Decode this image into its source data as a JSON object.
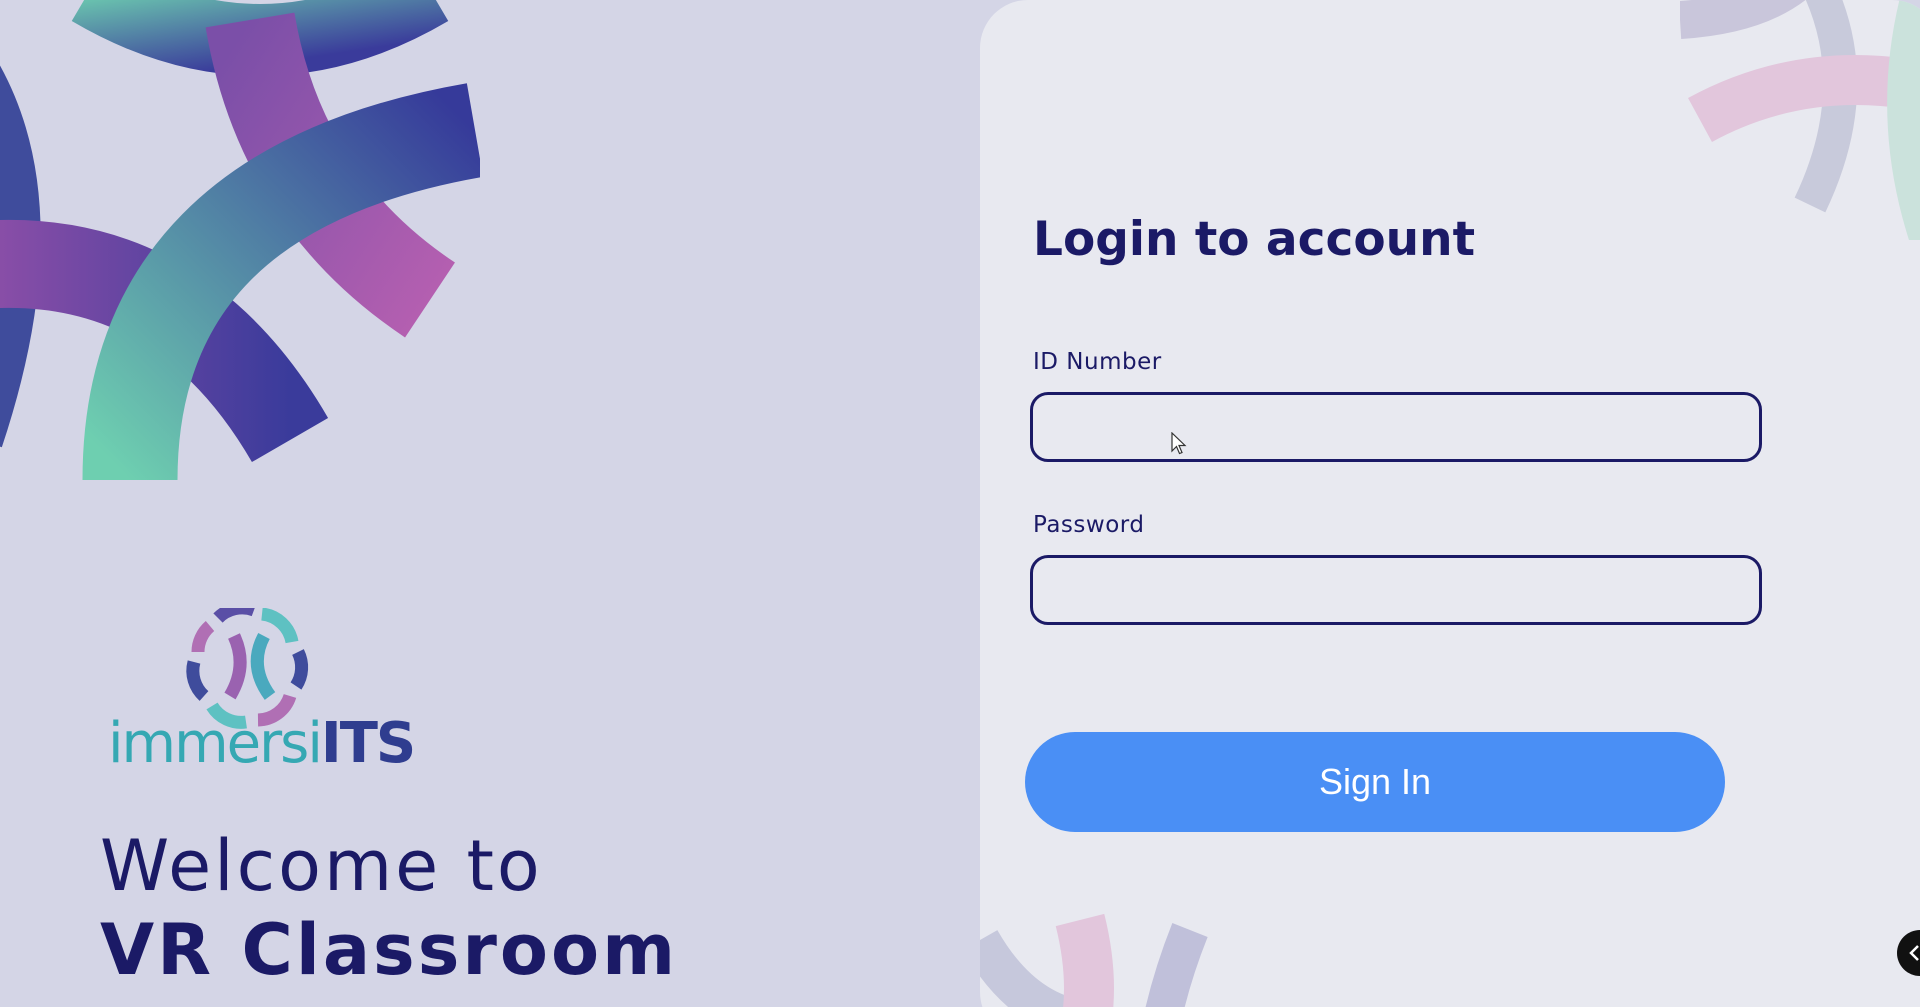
{
  "brand": {
    "logo_text_main": "immersi",
    "logo_text_accent": "ITS"
  },
  "welcome": {
    "line1": "Welcome to",
    "line2": "VR Classroom"
  },
  "login": {
    "title": "Login to account",
    "id_label": "ID Number",
    "id_value": "",
    "password_label": "Password",
    "password_value": "",
    "signin_label": "Sign In"
  },
  "icons": {
    "corner_button": "chevron-left-icon",
    "cursor": "mouse-pointer-icon"
  },
  "colors": {
    "page_background": "#d4d5e6",
    "panel_background": "#e8e9f0",
    "heading": "#1b1a66",
    "button": "#4a8ff5",
    "logo_teal": "#35a8b3",
    "logo_navy": "#2f3d8f"
  }
}
